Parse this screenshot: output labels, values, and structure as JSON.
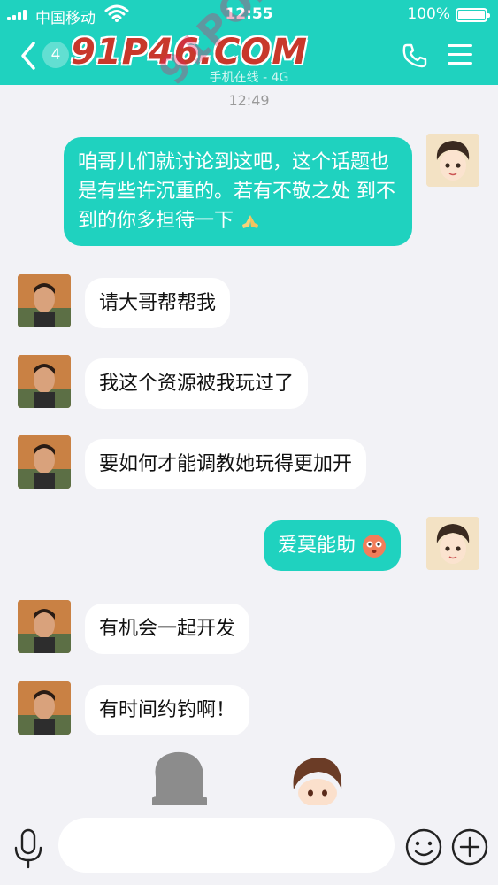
{
  "status_bar": {
    "carrier": "中国移动",
    "time": "12:55",
    "battery": "100%"
  },
  "header": {
    "unread_count": "4",
    "contact_name": "91P46.COM",
    "sub_status": "手机在线 - 4G"
  },
  "watermark": "91PORN.COM",
  "chat": {
    "timestamp": "12:49",
    "messages": [
      {
        "side": "out",
        "text": "咱哥儿们就讨论到这吧，这个话题也是有些许沉重的。若有不敬之处 到不到的你多担待一下"
      },
      {
        "side": "in",
        "text": "请大哥帮帮我"
      },
      {
        "side": "in",
        "text": "我这个资源被我玩过了"
      },
      {
        "side": "in",
        "text": "要如何才能调教她玩得更加开"
      },
      {
        "side": "out",
        "text": "爱莫能助"
      },
      {
        "side": "in",
        "text": "有机会一起开发"
      },
      {
        "side": "in",
        "text": "有时间约钓啊！"
      }
    ]
  },
  "input": {
    "placeholder": ""
  },
  "colors": {
    "accent": "#1fd2bf",
    "background": "#f2f2f6",
    "bubble_in": "#ffffff"
  },
  "icons": [
    "back-icon",
    "phone-icon",
    "menu-icon",
    "mic-icon",
    "emoji-icon",
    "plus-icon",
    "pray-emoji",
    "flushed-emoji"
  ]
}
